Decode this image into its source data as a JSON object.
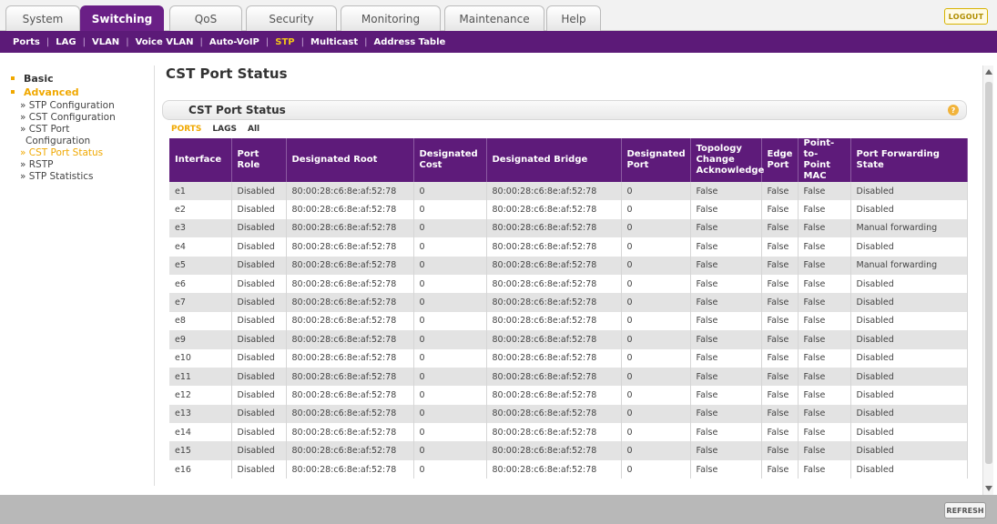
{
  "tabs": [
    {
      "label": "System"
    },
    {
      "label": "Switching"
    },
    {
      "label": "QoS"
    },
    {
      "label": "Security"
    },
    {
      "label": "Monitoring"
    },
    {
      "label": "Maintenance"
    },
    {
      "label": "Help"
    }
  ],
  "logout_label": "LOGOUT",
  "subnav": [
    "Ports",
    "LAG",
    "VLAN",
    "Voice VLAN",
    "Auto-VoIP",
    "STP",
    "Multicast",
    "Address Table"
  ],
  "leftnav": {
    "basic": "Basic",
    "advanced": "Advanced",
    "items": [
      "» STP Configuration",
      "» CST Configuration",
      "» CST Port",
      "Configuration",
      "» CST Port Status",
      "» RSTP",
      "» STP Statistics"
    ]
  },
  "page_title": "CST Port Status",
  "section_title": "CST Port Status",
  "filters": [
    "PORTS",
    "LAGS",
    "All"
  ],
  "table": {
    "headers": [
      "Interface",
      "Port Role",
      "Designated Root",
      "Designated Cost",
      "Designated Bridge",
      "Designated Port",
      "Topology Change Acknowledge",
      "Edge Port",
      "Point-to-Point MAC",
      "Port Forwarding State"
    ],
    "rows": [
      [
        "e1",
        "Disabled",
        "80:00:28:c6:8e:af:52:78",
        "0",
        "80:00:28:c6:8e:af:52:78",
        "0",
        "False",
        "False",
        "False",
        "Disabled"
      ],
      [
        "e2",
        "Disabled",
        "80:00:28:c6:8e:af:52:78",
        "0",
        "80:00:28:c6:8e:af:52:78",
        "0",
        "False",
        "False",
        "False",
        "Disabled"
      ],
      [
        "e3",
        "Disabled",
        "80:00:28:c6:8e:af:52:78",
        "0",
        "80:00:28:c6:8e:af:52:78",
        "0",
        "False",
        "False",
        "False",
        "Manual forwarding"
      ],
      [
        "e4",
        "Disabled",
        "80:00:28:c6:8e:af:52:78",
        "0",
        "80:00:28:c6:8e:af:52:78",
        "0",
        "False",
        "False",
        "False",
        "Disabled"
      ],
      [
        "e5",
        "Disabled",
        "80:00:28:c6:8e:af:52:78",
        "0",
        "80:00:28:c6:8e:af:52:78",
        "0",
        "False",
        "False",
        "False",
        "Manual forwarding"
      ],
      [
        "e6",
        "Disabled",
        "80:00:28:c6:8e:af:52:78",
        "0",
        "80:00:28:c6:8e:af:52:78",
        "0",
        "False",
        "False",
        "False",
        "Disabled"
      ],
      [
        "e7",
        "Disabled",
        "80:00:28:c6:8e:af:52:78",
        "0",
        "80:00:28:c6:8e:af:52:78",
        "0",
        "False",
        "False",
        "False",
        "Disabled"
      ],
      [
        "e8",
        "Disabled",
        "80:00:28:c6:8e:af:52:78",
        "0",
        "80:00:28:c6:8e:af:52:78",
        "0",
        "False",
        "False",
        "False",
        "Disabled"
      ],
      [
        "e9",
        "Disabled",
        "80:00:28:c6:8e:af:52:78",
        "0",
        "80:00:28:c6:8e:af:52:78",
        "0",
        "False",
        "False",
        "False",
        "Disabled"
      ],
      [
        "e10",
        "Disabled",
        "80:00:28:c6:8e:af:52:78",
        "0",
        "80:00:28:c6:8e:af:52:78",
        "0",
        "False",
        "False",
        "False",
        "Disabled"
      ],
      [
        "e11",
        "Disabled",
        "80:00:28:c6:8e:af:52:78",
        "0",
        "80:00:28:c6:8e:af:52:78",
        "0",
        "False",
        "False",
        "False",
        "Disabled"
      ],
      [
        "e12",
        "Disabled",
        "80:00:28:c6:8e:af:52:78",
        "0",
        "80:00:28:c6:8e:af:52:78",
        "0",
        "False",
        "False",
        "False",
        "Disabled"
      ],
      [
        "e13",
        "Disabled",
        "80:00:28:c6:8e:af:52:78",
        "0",
        "80:00:28:c6:8e:af:52:78",
        "0",
        "False",
        "False",
        "False",
        "Disabled"
      ],
      [
        "e14",
        "Disabled",
        "80:00:28:c6:8e:af:52:78",
        "0",
        "80:00:28:c6:8e:af:52:78",
        "0",
        "False",
        "False",
        "False",
        "Disabled"
      ],
      [
        "e15",
        "Disabled",
        "80:00:28:c6:8e:af:52:78",
        "0",
        "80:00:28:c6:8e:af:52:78",
        "0",
        "False",
        "False",
        "False",
        "Disabled"
      ],
      [
        "e16",
        "Disabled",
        "80:00:28:c6:8e:af:52:78",
        "0",
        "80:00:28:c6:8e:af:52:78",
        "0",
        "False",
        "False",
        "False",
        "Disabled"
      ]
    ]
  },
  "refresh_label": "REFRESH"
}
